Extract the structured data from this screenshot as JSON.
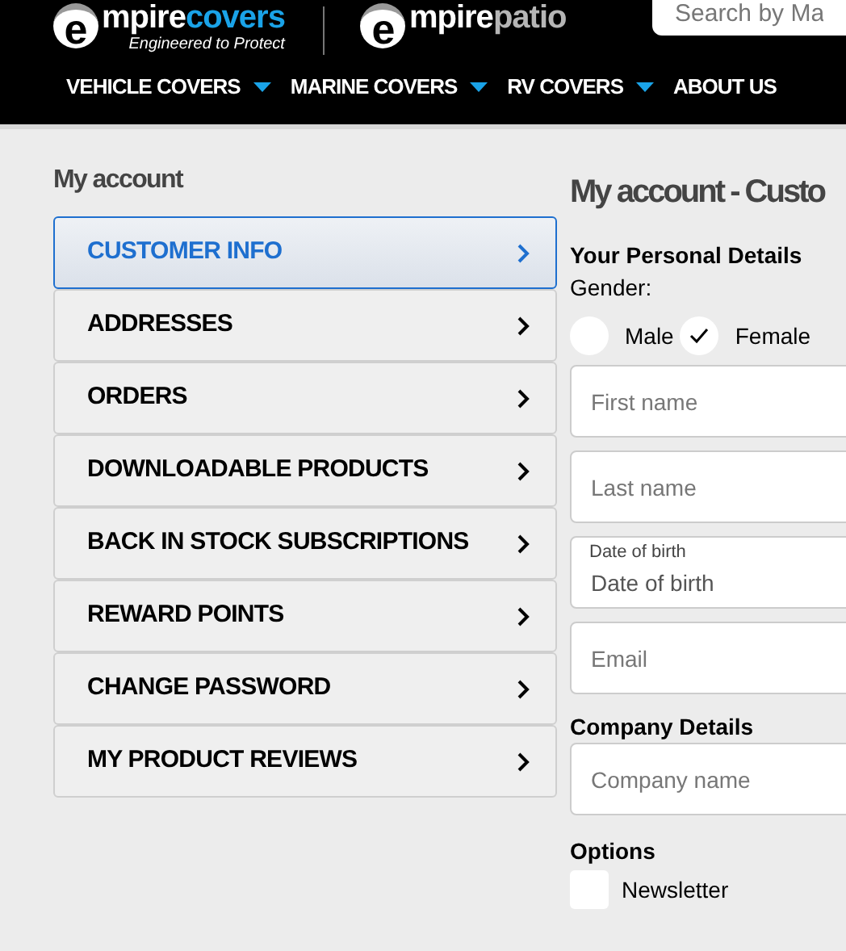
{
  "header": {
    "logos": [
      {
        "letter": "e",
        "word": "mpire",
        "accent": "covers",
        "tagline": "Engineered to Protect"
      },
      {
        "letter": "e",
        "word": "mpire",
        "accent": "patio"
      }
    ],
    "search": {
      "placeholder": "Search by Ma"
    }
  },
  "nav": [
    {
      "label": "VEHICLE COVERS",
      "dropdown": true
    },
    {
      "label": "MARINE COVERS",
      "dropdown": true
    },
    {
      "label": "RV COVERS",
      "dropdown": true
    },
    {
      "label": "ABOUT US",
      "dropdown": false
    }
  ],
  "sidebar": {
    "title": "My account",
    "items": [
      {
        "label": "CUSTOMER INFO",
        "selected": true
      },
      {
        "label": "ADDRESSES",
        "selected": false
      },
      {
        "label": "ORDERS",
        "selected": false
      },
      {
        "label": "DOWNLOADABLE PRODUCTS",
        "selected": false
      },
      {
        "label": "BACK IN STOCK SUBSCRIPTIONS",
        "selected": false
      },
      {
        "label": "REWARD POINTS",
        "selected": false
      },
      {
        "label": "CHANGE PASSWORD",
        "selected": false
      },
      {
        "label": "MY PRODUCT REVIEWS",
        "selected": false
      }
    ]
  },
  "main": {
    "title": "My account - Custo",
    "personal": {
      "heading": "Your Personal Details",
      "gender_label": "Gender:",
      "genders": [
        {
          "label": "Male",
          "selected": false
        },
        {
          "label": "Female",
          "selected": true
        }
      ],
      "fields": [
        {
          "placeholder": "First name"
        },
        {
          "placeholder": "Last name"
        },
        {
          "label": "Date of birth",
          "placeholder": "Date of birth"
        },
        {
          "placeholder": "Email"
        }
      ]
    },
    "company": {
      "heading": "Company Details",
      "fields": [
        {
          "placeholder": "Company name"
        }
      ]
    },
    "options": {
      "heading": "Options",
      "checkboxes": [
        {
          "label": "Newsletter",
          "checked": false
        }
      ]
    }
  }
}
